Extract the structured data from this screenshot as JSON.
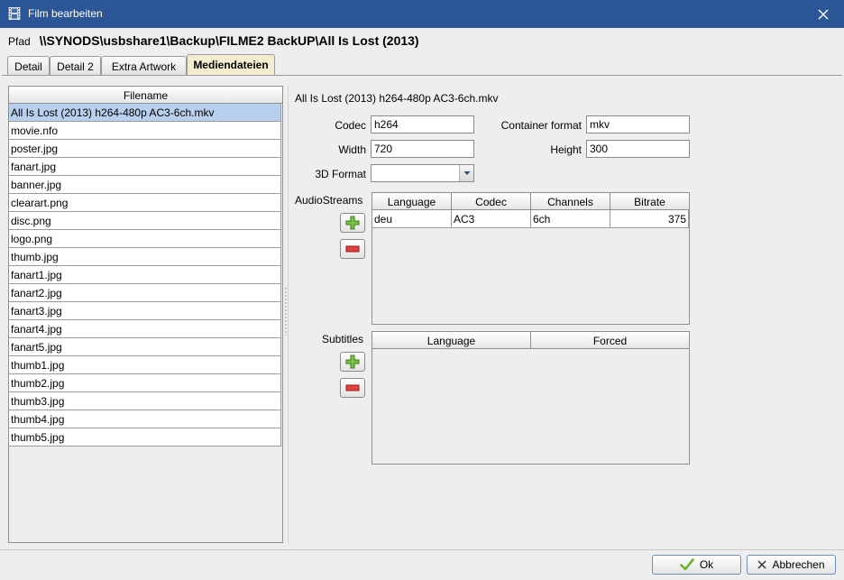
{
  "window": {
    "title": "Film bearbeiten"
  },
  "path": {
    "label": "Pfad",
    "value": "\\\\SYNODS\\usbshare1\\Backup\\FILME2  BackUP\\All Is Lost (2013)"
  },
  "tabs": [
    {
      "label": "Detail"
    },
    {
      "label": "Detail 2"
    },
    {
      "label": "Extra Artwork"
    },
    {
      "label": "Mediendateien",
      "active": true
    }
  ],
  "file_table": {
    "header": "Filename",
    "rows": [
      "All Is Lost (2013) h264-480p AC3-6ch.mkv",
      "movie.nfo",
      "poster.jpg",
      "fanart.jpg",
      "banner.jpg",
      "clearart.png",
      "disc.png",
      "logo.png",
      "thumb.jpg",
      "fanart1.jpg",
      "fanart2.jpg",
      "fanart3.jpg",
      "fanart4.jpg",
      "fanart5.jpg",
      "thumb1.jpg",
      "thumb2.jpg",
      "thumb3.jpg",
      "thumb4.jpg",
      "thumb5.jpg"
    ]
  },
  "details": {
    "filename": "All Is Lost (2013) h264-480p AC3-6ch.mkv",
    "codec_label": "Codec",
    "codec_value": "h264",
    "container_label": "Container format",
    "container_value": "mkv",
    "width_label": "Width",
    "width_value": "720",
    "height_label": "Height",
    "height_value": "300",
    "format3d_label": "3D Format",
    "format3d_value": ""
  },
  "audio": {
    "label": "AudioStreams",
    "columns": [
      "Language",
      "Codec",
      "Channels",
      "Bitrate"
    ],
    "rows": [
      {
        "language": "deu",
        "codec": "AC3",
        "channels": "6ch",
        "bitrate": "375"
      }
    ]
  },
  "subtitles": {
    "label": "Subtitles",
    "columns": [
      "Language",
      "Forced"
    ]
  },
  "buttons": {
    "ok": "Ok",
    "cancel": "Abbrechen"
  },
  "colors": {
    "titlebar": "#2b5797",
    "selection": "#b9cfee",
    "active_tab": "#f5ecd0"
  }
}
